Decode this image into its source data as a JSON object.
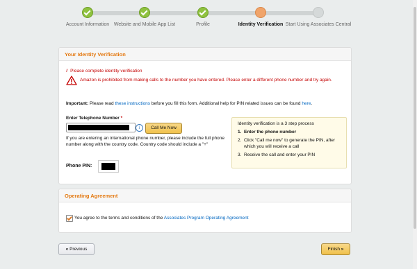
{
  "steps": [
    {
      "label": "Account Information",
      "state": "done"
    },
    {
      "label": "Website and Mobile App List",
      "state": "done"
    },
    {
      "label": "Profile",
      "state": "done"
    },
    {
      "label": "Identity Verification",
      "state": "active"
    },
    {
      "label": "Start Using Associates Central",
      "state": "todo"
    }
  ],
  "identity": {
    "heading": "Your Identity Verification",
    "error_required": "Please complete identity verification",
    "error_prohibited": "Amazon is prohibited from making calls to the number you have entered. Please enter a different phone number and try again.",
    "important_prefix": "Important:",
    "important_text_1": "Please read",
    "important_link_1": "these instructions",
    "important_text_2": "before you fill this form. Additional help for PIN related issues can be found",
    "important_link_2": "here",
    "important_end": ".",
    "phone_label": "Enter Telephone Number",
    "required_mark": "*",
    "call_button": "Call Me Now",
    "intl_note": "If you are entering an international phone number, please include the full phone number along with the country code. Country code should include a \"+\"",
    "pin_label": "Phone PIN:"
  },
  "tips": {
    "title": "Identity verification is a 3 step process",
    "steps": [
      {
        "n": "1.",
        "text": "Enter the phone number"
      },
      {
        "n": "2.",
        "text": "Click \"Call me now\" to generate the PIN, after which you will receive a call"
      },
      {
        "n": "3.",
        "text": "Receive the call and enter your PIN"
      }
    ]
  },
  "agreement": {
    "heading": "Operating Agreement",
    "text": "You agree to the terms and conditions of the",
    "link": "Associates Program Operating Agreement",
    "checked": true
  },
  "nav": {
    "previous_label": "Previous",
    "finish_label": "Finish"
  },
  "colors": {
    "accent": "#e47911",
    "link": "#0066c0",
    "error": "#c40000",
    "done": "#8fc23f",
    "active": "#f0a46a"
  }
}
